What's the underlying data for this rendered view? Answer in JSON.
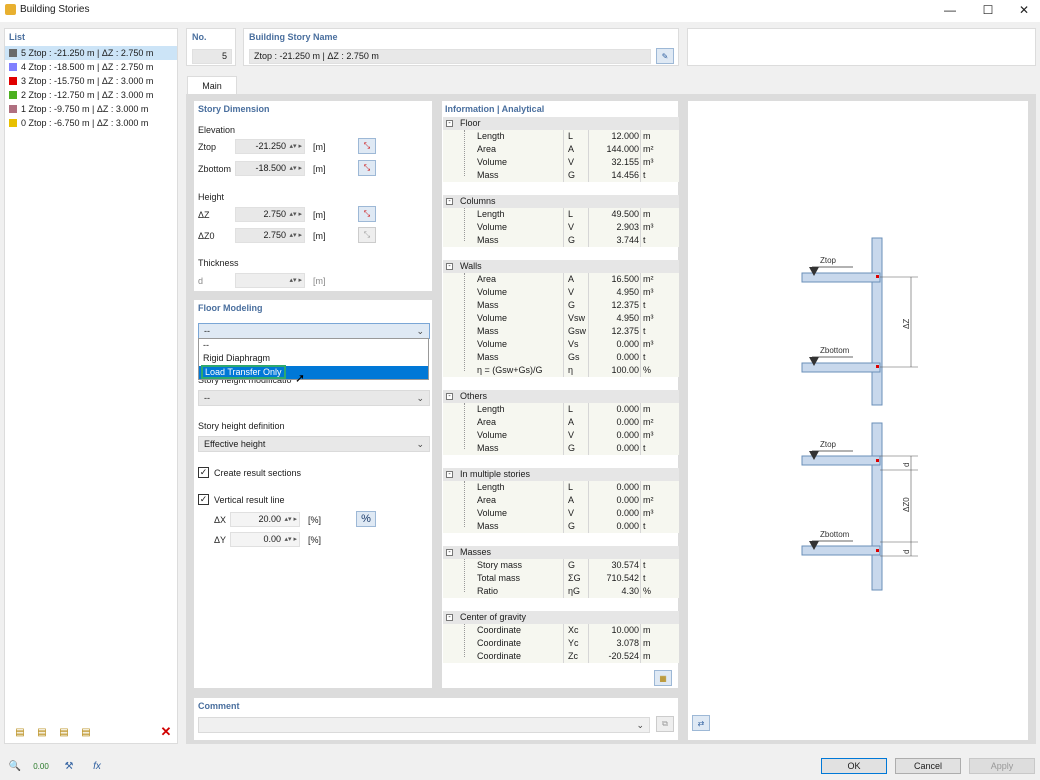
{
  "window": {
    "title": "Building Stories",
    "controls": [
      "—",
      "☐",
      "✕"
    ]
  },
  "list": {
    "header": "List",
    "items": [
      {
        "color": "#6a6a6a",
        "text": "5  Ztop : -21.250 m | ΔZ : 2.750 m"
      },
      {
        "color": "#8080ff",
        "text": "4  Ztop : -18.500 m | ΔZ : 2.750 m"
      },
      {
        "color": "#e00000",
        "text": "3  Ztop : -15.750 m | ΔZ : 3.000 m"
      },
      {
        "color": "#4cb020",
        "text": "2  Ztop : -12.750 m | ΔZ : 3.000 m"
      },
      {
        "color": "#b07080",
        "text": "1  Ztop : -9.750 m | ΔZ : 3.000 m"
      },
      {
        "color": "#e8c000",
        "text": "0  Ztop : -6.750 m | ΔZ : 3.000 m"
      }
    ]
  },
  "no": {
    "label": "No.",
    "value": "5"
  },
  "name": {
    "label": "Building Story Name",
    "value": "Ztop : -21.250 m | ΔZ : 2.750 m"
  },
  "tabs": [
    "Main"
  ],
  "story_dimension": {
    "title": "Story Dimension",
    "elevation": "Elevation",
    "ztop": "Ztop",
    "ztop_val": "-21.250",
    "zbottom": "Zbottom",
    "zbottom_val": "-18.500",
    "height": "Height",
    "dz": "ΔZ",
    "dz_val": "2.750",
    "dz0": "ΔZ0",
    "dz0_val": "2.750",
    "thickness": "Thickness",
    "d": "d",
    "unit_m": "[m]"
  },
  "floor_modeling": {
    "title": "Floor Modeling",
    "selected": "--",
    "options": [
      "--",
      "Rigid Diaphragm",
      "Load Transfer Only"
    ],
    "story_height_mod": "Story height modificatio",
    "mod_val": "--",
    "story_height_def": "Story height definition",
    "def_val": "Effective height",
    "create_sections": "Create result sections",
    "vertical_line": "Vertical result line",
    "dx": "ΔX",
    "dx_val": "20.00",
    "dy": "ΔY",
    "dy_val": "0.00",
    "unit_pct": "[%]",
    "pct_btn": "%"
  },
  "info": {
    "title": "Information | Analytical",
    "groups": [
      {
        "name": "Floor",
        "rows": [
          [
            "Length",
            "L",
            "12.000",
            "m"
          ],
          [
            "Area",
            "A",
            "144.000",
            "m²"
          ],
          [
            "Volume",
            "V",
            "32.155",
            "m³"
          ],
          [
            "Mass",
            "G",
            "14.456",
            "t"
          ]
        ]
      },
      {
        "name": "Columns",
        "rows": [
          [
            "Length",
            "L",
            "49.500",
            "m"
          ],
          [
            "Volume",
            "V",
            "2.903",
            "m³"
          ],
          [
            "Mass",
            "G",
            "3.744",
            "t"
          ]
        ]
      },
      {
        "name": "Walls",
        "rows": [
          [
            "Area",
            "A",
            "16.500",
            "m²"
          ],
          [
            "Volume",
            "V",
            "4.950",
            "m³"
          ],
          [
            "Mass",
            "G",
            "12.375",
            "t"
          ],
          [
            "Volume",
            "Vsw",
            "4.950",
            "m³"
          ],
          [
            "Mass",
            "Gsw",
            "12.375",
            "t"
          ],
          [
            "Volume",
            "Vs",
            "0.000",
            "m³"
          ],
          [
            "Mass",
            "Gs",
            "0.000",
            "t"
          ],
          [
            "η = (Gsw+Gs)/G",
            "η",
            "100.00",
            "%"
          ]
        ]
      },
      {
        "name": "Others",
        "rows": [
          [
            "Length",
            "L",
            "0.000",
            "m"
          ],
          [
            "Area",
            "A",
            "0.000",
            "m²"
          ],
          [
            "Volume",
            "V",
            "0.000",
            "m³"
          ],
          [
            "Mass",
            "G",
            "0.000",
            "t"
          ]
        ]
      },
      {
        "name": "In multiple stories",
        "rows": [
          [
            "Length",
            "L",
            "0.000",
            "m"
          ],
          [
            "Area",
            "A",
            "0.000",
            "m²"
          ],
          [
            "Volume",
            "V",
            "0.000",
            "m³"
          ],
          [
            "Mass",
            "G",
            "0.000",
            "t"
          ]
        ]
      },
      {
        "name": "Masses",
        "rows": [
          [
            "Story mass",
            "G",
            "30.574",
            "t"
          ],
          [
            "Total mass",
            "ΣG",
            "710.542",
            "t"
          ],
          [
            "Ratio",
            "ηG",
            "4.30",
            "%"
          ]
        ]
      },
      {
        "name": "Center of gravity",
        "rows": [
          [
            "Coordinate",
            "Xc",
            "10.000",
            "m"
          ],
          [
            "Coordinate",
            "Yc",
            "3.078",
            "m"
          ],
          [
            "Coordinate",
            "Zc",
            "-20.524",
            "m"
          ]
        ]
      }
    ]
  },
  "diagram": {
    "ztop": "Ztop",
    "zbottom": "Zbottom",
    "dz": "ΔZ",
    "dz0": "ΔZ0",
    "d": "d"
  },
  "comment": {
    "label": "Comment"
  },
  "buttons": {
    "ok": "OK",
    "cancel": "Cancel",
    "apply": "Apply"
  }
}
